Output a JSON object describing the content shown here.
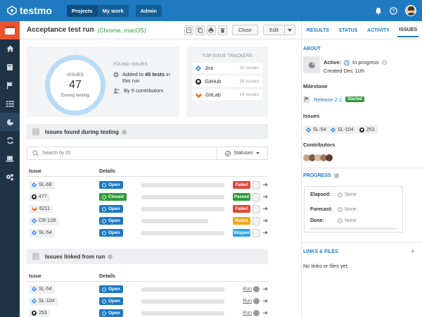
{
  "app": {
    "brand": "testmo",
    "accent": "#1f7ac2",
    "sidebar_color": "#1e3346"
  },
  "nav": {
    "projects": "Projects",
    "mywork": "My work",
    "admin": "Admin"
  },
  "header": {
    "title": "Acceptance test run",
    "subtitle": "(Chrome, macOS)",
    "close_label": "Close",
    "edit_label": "Edit"
  },
  "tabs": [
    "RESULTS",
    "STATUS",
    "ACTIVITY",
    "ISSUES"
  ],
  "summary": {
    "ring_label": "ISSUES",
    "ring_count": "47",
    "ring_caption": "During testing",
    "found_caption": "FOUND ISSUES",
    "added_prefix": "Added to ",
    "added_count": "45 tests",
    "added_suffix": " in",
    "added_suffix2": "this run",
    "contributors_prefix": "By ",
    "contributors_count": "5 contributors"
  },
  "trackers": {
    "title": "TOP ISSUE TRACKERS",
    "items": [
      {
        "name": "Jira",
        "count": "20 issues"
      },
      {
        "name": "GitHub",
        "count": "16 issues"
      },
      {
        "name": "GitLab",
        "count": "14 issues"
      }
    ]
  },
  "found_section": {
    "title": "Issues found during testing"
  },
  "search": {
    "placeholder": "Search by ID",
    "statuses_label": "Statuses"
  },
  "columns": {
    "issue": "Issue",
    "details": "Details"
  },
  "found_rows": [
    {
      "id": "SL-68",
      "tracker": "jira",
      "status": "Open",
      "result": "Failed"
    },
    {
      "id": "477",
      "tracker": "github",
      "status": "Closed",
      "result": "Passed"
    },
    {
      "id": "6211",
      "tracker": "gitlab",
      "status": "Open",
      "result": "Failed"
    },
    {
      "id": "CR-128",
      "tracker": "jira",
      "status": "Open",
      "result": "Retest"
    },
    {
      "id": "SL-54",
      "tracker": "jira",
      "status": "Open",
      "result": "Skipped"
    }
  ],
  "linked_section": {
    "title": "Issues linked from run"
  },
  "linked_rows": [
    {
      "id": "SL-54",
      "tracker": "jira",
      "status": "Open",
      "link": "Run"
    },
    {
      "id": "SL-104",
      "tracker": "jira",
      "status": "Open",
      "link": "Run"
    },
    {
      "id": "253",
      "tracker": "github",
      "status": "Open",
      "link": "Run"
    }
  ],
  "colors": {
    "open": "#1f7ac2",
    "closed": "#2f9a3a",
    "failed": "#e0483b",
    "passed": "#2f9a3a",
    "retest": "#f0a81c",
    "skipped": "#2aa4e3"
  },
  "about": {
    "heading": "ABOUT",
    "active_label": "Active:",
    "active_value": "In progress",
    "created": "Created Dec 11th",
    "milestone_label": "Milestone",
    "milestone_name": "Release 2.1",
    "milestone_badge": "Started",
    "issues_label": "Issues",
    "issues": [
      {
        "id": "SL-54",
        "tracker": "jira"
      },
      {
        "id": "SL-104",
        "tracker": "jira"
      },
      {
        "id": "253",
        "tracker": "github"
      }
    ],
    "contributors_label": "Contributors"
  },
  "progress": {
    "heading": "PROGRESS",
    "elapsed_label": "Elapsed:",
    "elapsed_value": "None",
    "forecast_label": "Forecast:",
    "forecast_value": "None",
    "done_label": "Done:",
    "done_value": "None"
  },
  "links": {
    "heading": "LINKS & FILES",
    "empty": "No links or files yet.",
    "add": "+"
  }
}
